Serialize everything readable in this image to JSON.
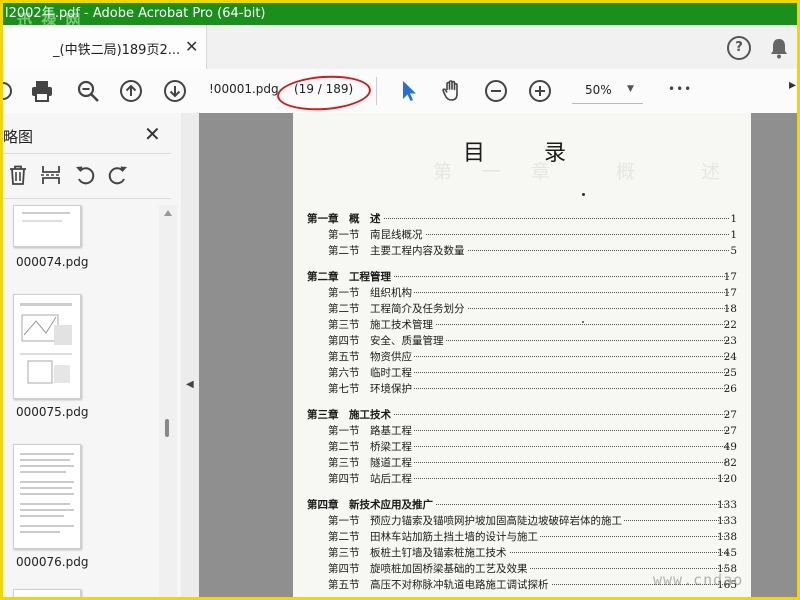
{
  "window": {
    "title": "l2002年.pdf - Adobe Acrobat Pro (64-bit)",
    "watermark_top": "迅 禄 网",
    "watermark_bottom": "www.cndao"
  },
  "tab": {
    "label": "_(中铁二局)189页2...",
    "close": "✕"
  },
  "header": {
    "help": "?"
  },
  "toolbar": {
    "page_input": "!00001.pdg",
    "page_count": "(19 / 189)",
    "zoom": "50%",
    "zoom_caret": "▼",
    "more": "•••"
  },
  "panel": {
    "title": "略图",
    "close": "✕",
    "thumbnails": [
      {
        "label": "000074.pdg"
      },
      {
        "label": "000075.pdg"
      },
      {
        "label": "000076.pdg"
      }
    ]
  },
  "document": {
    "title": "目 录",
    "ghost": "第一章 概 述",
    "toc": [
      {
        "label": "第一章　概　述",
        "page": "1",
        "level": 1
      },
      {
        "label": "第一节　南昆线概况",
        "page": "1",
        "level": 2
      },
      {
        "label": "第二节　主要工程内容及数量",
        "page": "5",
        "level": 2
      },
      {
        "label": "第二章　工程管理",
        "page": "17",
        "level": 1
      },
      {
        "label": "第一节　组织机构",
        "page": "17",
        "level": 2
      },
      {
        "label": "第二节　工程简介及任务划分",
        "page": "18",
        "level": 2
      },
      {
        "label": "第三节　施工技术管理",
        "page": "22",
        "level": 2
      },
      {
        "label": "第四节　安全、质量管理",
        "page": "23",
        "level": 2
      },
      {
        "label": "第五节　物资供应",
        "page": "24",
        "level": 2
      },
      {
        "label": "第六节　临时工程",
        "page": "25",
        "level": 2
      },
      {
        "label": "第七节　环境保护",
        "page": "26",
        "level": 2
      },
      {
        "label": "第三章　施工技术",
        "page": "27",
        "level": 1
      },
      {
        "label": "第一节　路基工程",
        "page": "27",
        "level": 2
      },
      {
        "label": "第二节　桥梁工程",
        "page": "49",
        "level": 2
      },
      {
        "label": "第三节　隧道工程",
        "page": "82",
        "level": 2
      },
      {
        "label": "第四节　站后工程",
        "page": "120",
        "level": 2
      },
      {
        "label": "第四章　新技术应用及推广",
        "page": "133",
        "level": 1
      },
      {
        "label": "第一节　预应力锚索及锚喷网护坡加固高陡边坡破碎岩体的施工",
        "page": "133",
        "level": 2
      },
      {
        "label": "第二节　田林车站加筋土挡土墙的设计与施工",
        "page": "138",
        "level": 2
      },
      {
        "label": "第三节　板桩土钉墙及锚索桩施工技术",
        "page": "145",
        "level": 2
      },
      {
        "label": "第四节　旋喷桩加固桥梁基础的工艺及效果",
        "page": "158",
        "level": 2
      },
      {
        "label": "第五节　高压不对称脉冲轨道电路施工调试探析",
        "page": "165",
        "level": 2
      }
    ]
  },
  "colors": {
    "titlebar": "#1b8f1b",
    "frame": "#f2d600",
    "accent_blue": "#2a6fd6",
    "annotation_red": "#d51a1a"
  }
}
